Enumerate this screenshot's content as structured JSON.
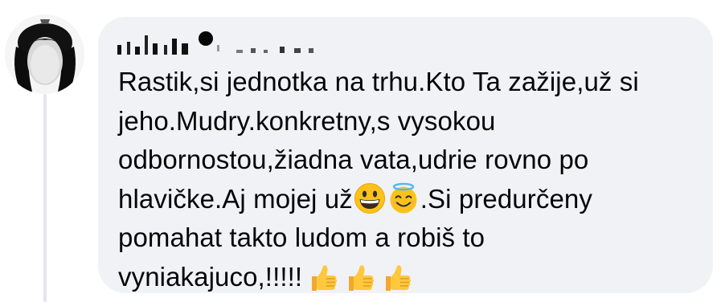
{
  "comment": {
    "author_name": "redacted",
    "text_lines": [
      "Rastik,si jednotka na trhu.Kto Ta zažije,už si",
      "jeho.Mudry.konkretny,s vysokou",
      "odbornostou,žiadna vata,udrie rovno po",
      "hlavičke.Aj mojej už",
      ".Si predurčeny",
      "pomahat takto ludom a robiš to",
      "vyniakajuco,!!!!!"
    ],
    "emojis": {
      "line4": [
        "grinning-face",
        "smiling-face-with-halo"
      ],
      "line7": [
        "thumbs-up",
        "thumbs-up",
        "thumbs-up"
      ]
    }
  },
  "colors": {
    "bubble": "#f0f2f5",
    "text": "#050505",
    "thread_line": "#e4e6eb",
    "emoji_yellow": "#fcc21b",
    "thumb_yellow": "#ffc83d"
  }
}
